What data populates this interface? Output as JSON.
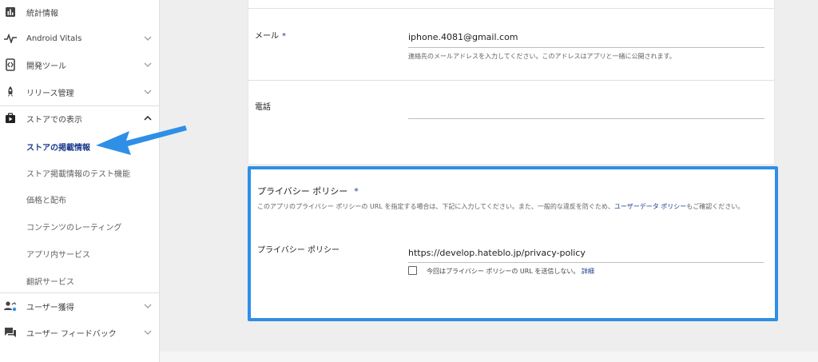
{
  "sidebar": {
    "items": [
      {
        "label": "統計情報",
        "icon": "bar-chart-icon"
      },
      {
        "label": "Android Vitals",
        "icon": "vitals-pulse-icon"
      },
      {
        "label": "開発ツール",
        "icon": "dev-tools-icon"
      },
      {
        "label": "リリース管理",
        "icon": "rocket-icon"
      },
      {
        "label": "ストアでの表示",
        "icon": "store-bag-icon"
      },
      {
        "label": "ユーザー獲得",
        "icon": "user-acquisition-icon"
      },
      {
        "label": "ユーザー フィードバック",
        "icon": "feedback-icon"
      }
    ],
    "subitems": [
      {
        "label": "ストアの掲載情報",
        "active": true
      },
      {
        "label": "ストア掲載情報のテスト機能"
      },
      {
        "label": "価格と配布"
      },
      {
        "label": "コンテンツのレーティング"
      },
      {
        "label": "アプリ内サービス"
      },
      {
        "label": "翻訳サービス"
      }
    ]
  },
  "contact": {
    "email_label": "メール",
    "required_mark": "*",
    "email_value": "iphone.4081@gmail.com",
    "email_help": "連絡先のメールアドレスを入力してください。このアドレスはアプリと一緒に公開されます。",
    "phone_label": "電話",
    "phone_value": ""
  },
  "privacy": {
    "title": "プライバシー ポリシー",
    "required_mark": "*",
    "desc_part1": "このアプリのプライバシー ポリシーの URL を指定する場合は、下記に入力してください。また、一般的な違反を防ぐため、",
    "desc_link": "ユーザーデータ ポリシー",
    "desc_part2": "もご確認ください。",
    "field_label": "プライバシー ポリシー",
    "url_value": "https://develop.hateblo.jp/privacy-policy",
    "checkbox_label": "今回はプライバシー ポリシーの URL を送信しない。",
    "details_link": "詳細"
  },
  "colors": {
    "accent": "#2f8fe6",
    "link": "#1a3a8c"
  }
}
